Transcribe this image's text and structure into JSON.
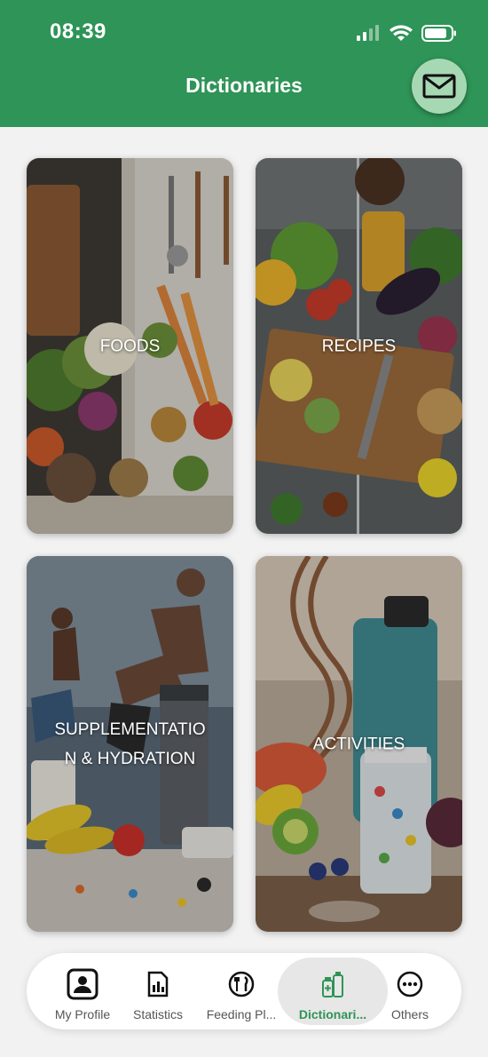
{
  "status_bar": {
    "time": "08:39"
  },
  "header": {
    "title": "Dictionaries"
  },
  "cards": [
    {
      "label": "FOODS"
    },
    {
      "label": "RECIPES"
    },
    {
      "label": "SUPPLEMENTATION & HYDRATION"
    },
    {
      "label": "ACTIVITIES"
    }
  ],
  "tabbar": {
    "items": [
      {
        "label": "My Profile",
        "icon": "profile-icon"
      },
      {
        "label": "Statistics",
        "icon": "statistics-icon"
      },
      {
        "label": "Feeding Pl...",
        "icon": "cutlery-icon"
      },
      {
        "label": "Dictionari...",
        "icon": "bottles-icon",
        "active": true
      },
      {
        "label": "Others",
        "icon": "more-icon"
      }
    ]
  },
  "colors": {
    "brand": "#2e9457",
    "mail_button": "#a7d8b4",
    "background": "#f2f2f2"
  }
}
